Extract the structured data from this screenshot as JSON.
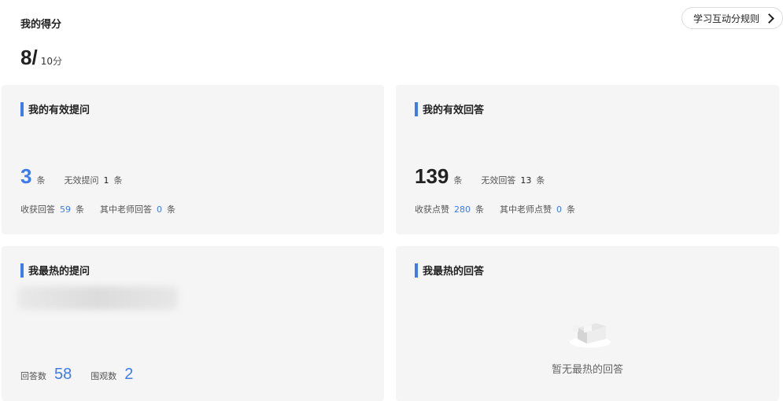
{
  "header": {
    "title": "我的得分",
    "score": "8",
    "slash": "/",
    "total": "10",
    "unit": "分",
    "rules_label": "学习互动分规则"
  },
  "questions": {
    "title": "我的有效提问",
    "count": "3",
    "unit": "条",
    "invalid_label": "无效提问",
    "invalid_count": "1",
    "answers_label": "收获回答",
    "answers_count": "59",
    "teacher_label": "其中老师回答",
    "teacher_count": "0"
  },
  "answers": {
    "title": "我的有效回答",
    "count": "139",
    "unit": "条",
    "invalid_label": "无效回答",
    "invalid_count": "13",
    "likes_label": "收获点赞",
    "likes_count": "280",
    "teacher_label": "其中老师点赞",
    "teacher_count": "0"
  },
  "hot_question": {
    "title": "我最热的提问",
    "answers_label": "回答数",
    "answers_count": "58",
    "views_label": "围观数",
    "views_count": "2"
  },
  "hot_answer": {
    "title": "我最热的回答",
    "empty_text": "暂无最热的回答",
    "empty_icon": "empty-box-icon"
  },
  "colors": {
    "accent": "#3d7bef",
    "card_bg": "#f5f5f5"
  }
}
